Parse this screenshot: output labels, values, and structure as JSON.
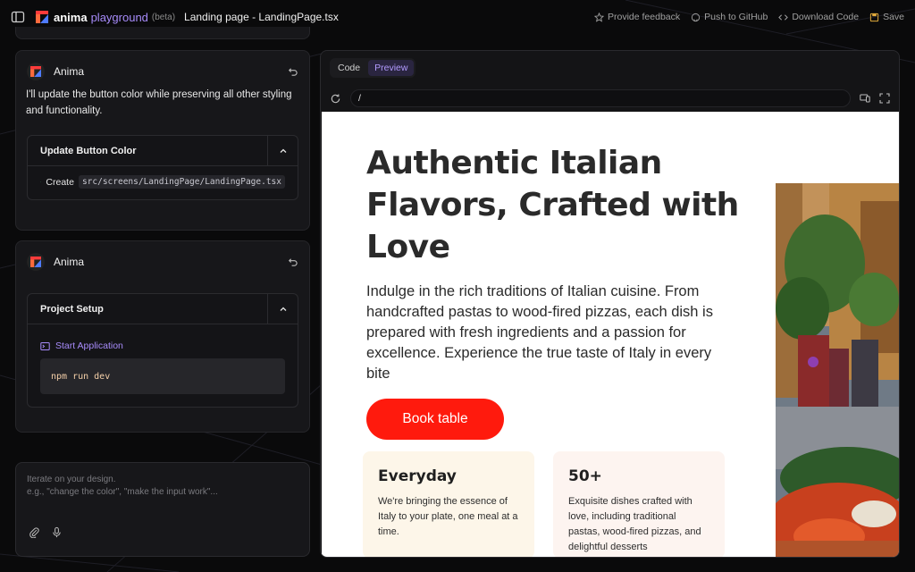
{
  "topbar": {
    "brand": "anima",
    "brand_sub": "playground",
    "beta": "(beta)",
    "page_title": "Landing page - LandingPage.tsx",
    "actions": {
      "feedback": "Provide feedback",
      "github": "Push to GitHub",
      "download": "Download Code",
      "save": "Save"
    }
  },
  "chat": {
    "msg1": {
      "sender": "Anima",
      "text": "I'll update the button color while preserving all other styling and functionality.",
      "task_title": "Update Button Color",
      "step_label": "Create",
      "step_path": "src/screens/LandingPage/LandingPage.tsx"
    },
    "msg2": {
      "sender": "Anima",
      "task_title": "Project Setup",
      "step_label": "Start Application",
      "command": "npm run dev"
    },
    "prompt": {
      "line1": "Iterate on your design.",
      "line2": "e.g., \"change the color\", \"make the input work\"..."
    }
  },
  "preview": {
    "tabs": [
      "Code",
      "Preview"
    ],
    "active_tab": "Preview",
    "url": "/"
  },
  "site": {
    "hero_title": "Authentic Italian Flavors, Crafted with Love",
    "hero_text": "Indulge in the rich traditions of Italian cuisine. From handcrafted pastas to wood-fired pizzas, each dish is prepared with fresh ingredients and a passion for excellence. Experience the true taste of Italy in every bite",
    "cta": "Book table",
    "cta_color": "#ff1a0d",
    "features": [
      {
        "title": "Everyday",
        "text": "We're bringing the essence of Italy to your plate, one meal at a time."
      },
      {
        "title": "50+",
        "text": "Exquisite dishes crafted with love, including traditional pastas, wood-fired pizzas, and delightful desserts"
      }
    ]
  },
  "colors": {
    "accent": "#a78bfa",
    "background": "#0a0a0b",
    "card": "#17171a"
  }
}
